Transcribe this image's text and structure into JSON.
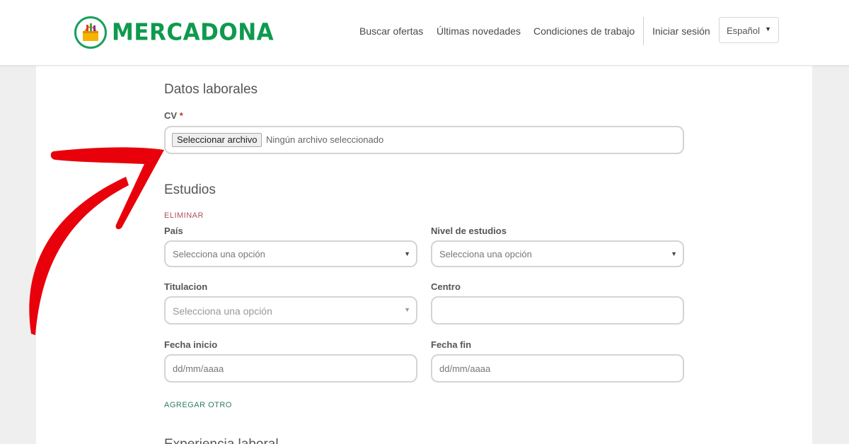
{
  "header": {
    "logo_text": "MERCADONA",
    "nav": [
      "Buscar ofertas",
      "Últimas novedades",
      "Condiciones de trabajo"
    ],
    "login": "Iniciar sesión",
    "language": "Español"
  },
  "datos_laborales": {
    "title": "Datos laborales",
    "cv_label": "CV",
    "required_mark": "*",
    "file_button": "Seleccionar archivo",
    "file_status": "Ningún archivo seleccionado"
  },
  "estudios": {
    "title": "Estudios",
    "delete_link": "ELIMINAR",
    "pais_label": "País",
    "pais_value": "Selecciona una opción",
    "nivel_label": "Nivel de estudios",
    "nivel_value": "Selecciona una opción",
    "titulacion_label": "Titulacion",
    "titulacion_value": "Selecciona una opción",
    "centro_label": "Centro",
    "centro_value": "",
    "fecha_inicio_label": "Fecha inicio",
    "fecha_inicio_placeholder": "dd/mm/aaaa",
    "fecha_fin_label": "Fecha fin",
    "fecha_fin_placeholder": "dd/mm/aaaa",
    "add_link": "AGREGAR OTRO"
  },
  "experiencia": {
    "title": "Experiencia laboral"
  },
  "colors": {
    "brand_green": "#0e9a4e",
    "annotation_red": "#e8000b",
    "delete_red": "#b0505a",
    "add_green": "#2e7d5b"
  }
}
